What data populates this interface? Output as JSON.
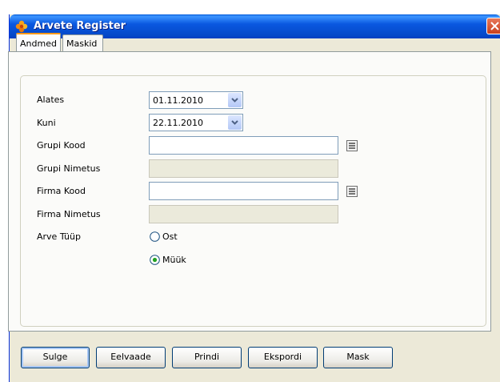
{
  "window": {
    "title": "Arvete Register",
    "colors": {
      "titlebar": "#0a58e0",
      "face": "#ece9d8",
      "close": "#d4522e"
    }
  },
  "tabs": [
    {
      "label": "Andmed",
      "active": true
    },
    {
      "label": "Maskid",
      "active": false
    }
  ],
  "form": {
    "alates": {
      "label": "Alates",
      "value": "01.11.2010"
    },
    "kuni": {
      "label": "Kuni",
      "value": "22.11.2010"
    },
    "grupi_kood": {
      "label": "Grupi Kood",
      "value": ""
    },
    "grupi_nimetus": {
      "label": "Grupi Nimetus",
      "value": ""
    },
    "firma_kood": {
      "label": "Firma Kood",
      "value": ""
    },
    "firma_nimetus": {
      "label": "Firma Nimetus",
      "value": ""
    },
    "arve_tuup": {
      "label": "Arve Tüüp",
      "options": [
        {
          "label": "Ost",
          "selected": false
        },
        {
          "label": "Müük",
          "selected": true
        }
      ]
    }
  },
  "buttons": {
    "sulge": "Sulge",
    "eelvaade": "Eelvaade",
    "prindi": "Prindi",
    "ekspordi": "Ekspordi",
    "mask": "Mask"
  },
  "icons": {
    "app": "flower-icon",
    "close": "close-icon",
    "dropdown": "chevron-down-icon",
    "lookup": "list-icon"
  }
}
